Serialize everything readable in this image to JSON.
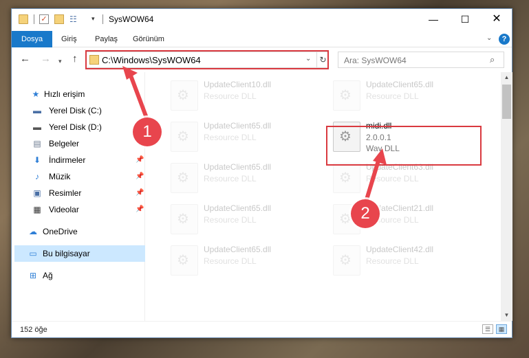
{
  "window": {
    "title": "SysWOW64",
    "min_glyph": "—",
    "max_glyph": "☐",
    "close_glyph": "✕"
  },
  "quick_access_toolbar": {
    "dropdown_glyph": "▾"
  },
  "ribbon": {
    "tabs": [
      "Dosya",
      "Giriş",
      "Paylaş",
      "Görünüm"
    ],
    "help_glyph": "?"
  },
  "navigation": {
    "back_glyph": "←",
    "forward_glyph": "→",
    "recent_glyph": "▾",
    "up_glyph": "↑",
    "address": "C:\\Windows\\SysWOW64",
    "search_placeholder": "Ara: SysWOW64"
  },
  "sidebar": {
    "items": [
      {
        "label": "Hızlı erişim",
        "icon": "star-icon",
        "glyph": "★",
        "color": "#2f7fd6"
      },
      {
        "label": "Yerel Disk (C:)",
        "icon": "drive-icon",
        "glyph": "▬",
        "color": "#4a6fa5"
      },
      {
        "label": "Yerel Disk (D:)",
        "icon": "drive-icon",
        "glyph": "▬",
        "color": "#555555"
      },
      {
        "label": "Belgeler",
        "icon": "documents-icon",
        "glyph": "▤",
        "color": "#6b7a8f"
      },
      {
        "label": "İndirmeler",
        "icon": "download-icon",
        "glyph": "⬇",
        "color": "#2f7fd6",
        "pinned": true
      },
      {
        "label": "Müzik",
        "icon": "music-icon",
        "glyph": "♪",
        "color": "#2f7fd6",
        "pinned": true
      },
      {
        "label": "Resimler",
        "icon": "pictures-icon",
        "glyph": "▣",
        "color": "#4a6fa5",
        "pinned": true
      },
      {
        "label": "Videolar",
        "icon": "videos-icon",
        "glyph": "▦",
        "color": "#333333",
        "pinned": true
      },
      {
        "label": "OneDrive",
        "icon": "cloud-icon",
        "glyph": "☁",
        "color": "#2f7fd6"
      },
      {
        "label": "Bu bilgisayar",
        "icon": "computer-icon",
        "glyph": "▭",
        "color": "#2f7fd6",
        "selected": true
      },
      {
        "label": "Ağ",
        "icon": "network-icon",
        "glyph": "⊞",
        "color": "#2f7fd6"
      }
    ]
  },
  "files": [
    {
      "name": "UpdateClient10.dll",
      "line1": "Resource DLL",
      "line2": ""
    },
    {
      "name": "UpdateClient65.dll",
      "line1": "Resource DLL",
      "line2": ""
    },
    {
      "name": "UpdateClient65.dll",
      "line1": "Resource DLL",
      "line2": ""
    },
    {
      "name": "midi.dll",
      "line1": "2.0.0.1",
      "line2": "Wav DLL"
    },
    {
      "name": "UpdateClient65.dll",
      "line1": "Resource DLL",
      "line2": ""
    },
    {
      "name": "UpdateClient63.dll",
      "line1": "Resource DLL",
      "line2": ""
    },
    {
      "name": "UpdateClient65.dll",
      "line1": "Resource DLL",
      "line2": ""
    },
    {
      "name": "UpdateClient21.dll",
      "line1": "Resource DLL",
      "line2": ""
    },
    {
      "name": "UpdateClient65.dll",
      "line1": "Resource DLL",
      "line2": ""
    },
    {
      "name": "UpdateClient42.dll",
      "line1": "Resource DLL",
      "line2": ""
    }
  ],
  "status": {
    "count": "152 öğe"
  },
  "annotations": {
    "step1": "1",
    "step2": "2",
    "color": "#e8454d"
  }
}
